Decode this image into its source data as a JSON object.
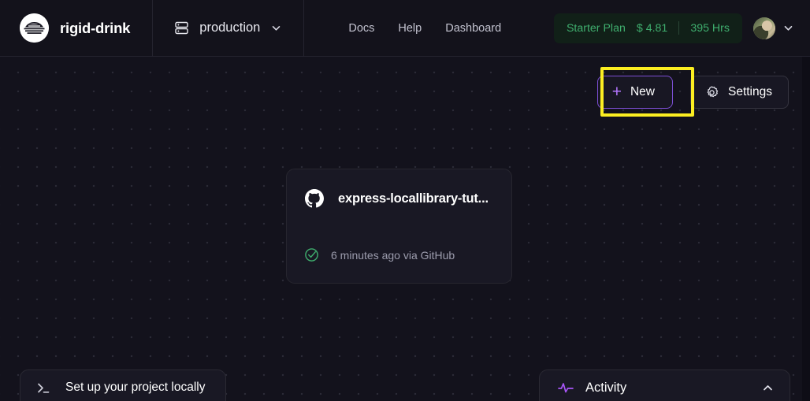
{
  "header": {
    "brand_name": "rigid-drink",
    "logo_icon": "circular-logo-icon",
    "environment": {
      "icon": "server-stack-icon",
      "label": "production",
      "chevron": "chevron-down-icon"
    },
    "nav_links": [
      {
        "label": "Docs"
      },
      {
        "label": "Help"
      },
      {
        "label": "Dashboard"
      }
    ],
    "plan_badge": {
      "plan_name": "Starter Plan",
      "cost": "$ 4.81",
      "hours": "395 Hrs"
    },
    "account": {
      "avatar_icon": "user-avatar",
      "chevron": "chevron-down-icon"
    }
  },
  "toolbar": {
    "new_label": "New",
    "new_icon": "plus-icon",
    "settings_label": "Settings",
    "settings_icon": "gear-icon",
    "highlight_color": "#fcee21",
    "accent_color": "#b476ff"
  },
  "projects": [
    {
      "source_icon": "github-icon",
      "name": "express-locallibrary-tut...",
      "status_icon": "check-circle-icon",
      "meta": "6 minutes ago via GitHub"
    }
  ],
  "bottom_bar": {
    "local_setup": {
      "icon": "terminal-icon",
      "label": "Set up your project locally"
    },
    "activity": {
      "icon": "activity-pulse-icon",
      "label": "Activity",
      "chevron": "chevron-up-icon"
    }
  }
}
